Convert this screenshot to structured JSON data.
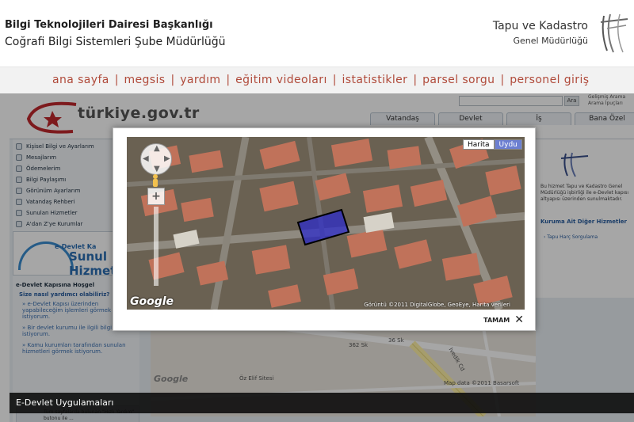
{
  "header": {
    "org_line1": "Bilgi Teknolojileri Dairesi Başkanlığı",
    "org_line2": "Coğrafi Bilgi Sistemleri Şube Müdürlüğü",
    "right_line1": "Tapu ve Kadastro",
    "right_line2": "Genel Müdürlüğü",
    "logo_icon": "tkgm-logo"
  },
  "nav": {
    "items": [
      "ana sayfa",
      "megsis",
      "yardım",
      "eğitim videoları",
      "istatistikler",
      "parsel sorgu",
      "personel giriş"
    ],
    "separator": "|"
  },
  "background_page": {
    "site_name": "türkiye.gov.tr",
    "search_button": "Ara",
    "search_advanced": "Gelişmiş Arama\nArama İpuçları",
    "tabs": [
      "Vatandaş",
      "Devlet",
      "İş",
      "Bana Özel"
    ],
    "sidebar_items": [
      "Kişisel Bilgi ve Ayarlarım",
      "Mesajlarım",
      "Ödemelerim",
      "Bilgi Paylaşımı",
      "Görünüm Ayarlarım",
      "Vatandaş Rehberi",
      "Sunulan Hizmetler",
      "A'dan Z'ye Kurumlar",
      "İletişim Merkezi"
    ],
    "banner_small": "e-Devlet Ka",
    "banner_big": "Sunul Hizmet",
    "welcome": "e-Devlet Kapısına Hoşgel",
    "help_q": "Size nasıl yardımcı olabiliriz?",
    "help_links": [
      "» e-Devlet Kapısı üzerinden yapabileceğim işlemleri görmek istiyorum.",
      "» Bir devlet kurumu ile ilgili bilgi almak istiyorum.",
      "» Kamu kurumları tarafından sunulan hizmetleri görmek istiyorum."
    ],
    "info_text": "Tüm sayfalarda bulunan \"Hızlı Yardım\" butonu ile ...",
    "right_text": "Bu hizmet Tapu ve Kadastro Genel Müdürlüğü işbirliği ile e-Devlet kapısı altyapısı üzerinden sunulmaktadır.",
    "right_heading": "Kuruma Ait Diğer Hizmetler",
    "right_link": "› Tapu Harç Sorgulama",
    "map_labels": [
      "362 Sk",
      "36 Sk",
      "Ivedik Cd",
      "Öz Elif Sitesi"
    ],
    "map_footer": "Map data ©2011 Basarsoft",
    "map_google": "Google"
  },
  "modal": {
    "map_type_options": [
      "Harita",
      "Uydu"
    ],
    "map_type_selected": "Uydu",
    "google_logo": "Google",
    "map_data": "Görüntü ©2011 DigitalGlobe, GeoEye, Harita verileri",
    "ok_label": "TAMAM",
    "close_icon": "close-x-icon"
  },
  "bottom_bar": {
    "title": "E-Devlet Uygulamaları"
  }
}
